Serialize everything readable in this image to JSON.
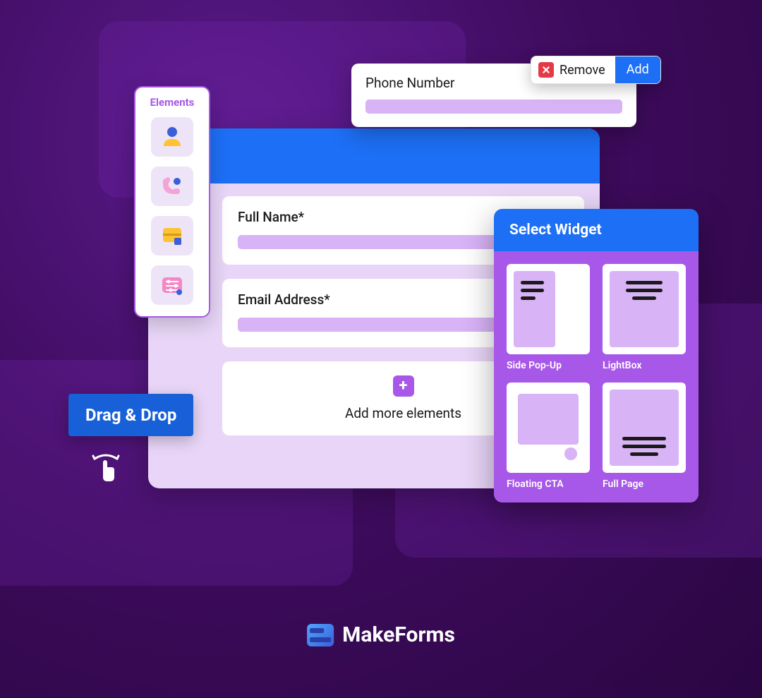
{
  "elements_panel": {
    "title": "Elements"
  },
  "builder": {
    "fields": [
      {
        "label": "Full Name*"
      },
      {
        "label": "Email Address*"
      }
    ],
    "add_more": "Add more elements"
  },
  "phone_card": {
    "label": "Phone Number"
  },
  "toolbar": {
    "remove": "Remove",
    "add": "Add"
  },
  "drag_badge": "Drag & Drop",
  "widget_panel": {
    "title": "Select Widget",
    "items": [
      "Side Pop-Up",
      "LightBox",
      "Floating CTA",
      "Full Page"
    ]
  },
  "brand": "MakeForms"
}
